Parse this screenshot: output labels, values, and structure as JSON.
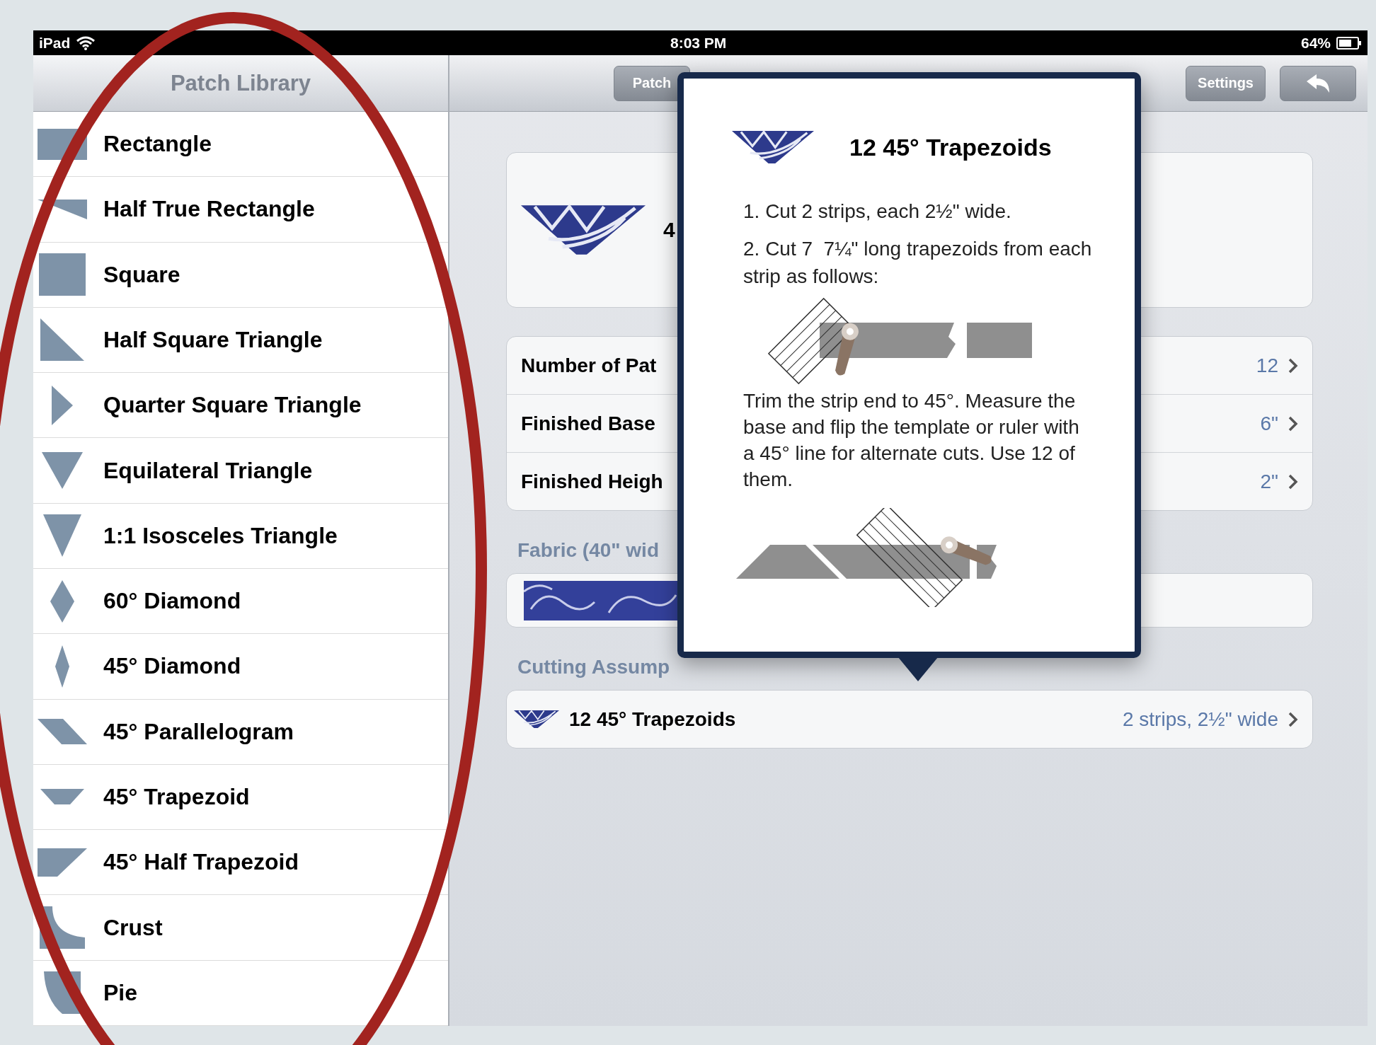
{
  "status_bar": {
    "carrier": "iPad",
    "time": "8:03 PM",
    "battery": "64%"
  },
  "sidebar": {
    "title": "Patch Library",
    "items": [
      {
        "label": "Rectangle",
        "selected": false
      },
      {
        "label": "Half True Rectangle",
        "selected": false
      },
      {
        "label": "Square",
        "selected": false
      },
      {
        "label": "Half Square Triangle",
        "selected": false
      },
      {
        "label": "Quarter Square Triangle",
        "selected": false
      },
      {
        "label": "Equilateral Triangle",
        "selected": false
      },
      {
        "label": "1:1 Isosceles Triangle",
        "selected": false
      },
      {
        "label": "60° Diamond",
        "selected": false
      },
      {
        "label": "45° Diamond",
        "selected": false
      },
      {
        "label": "45° Parallelogram",
        "selected": false
      },
      {
        "label": "45° Trapezoid",
        "selected": false
      },
      {
        "label": "45° Half Trapezoid",
        "selected": false
      },
      {
        "label": "Crust",
        "selected": false
      },
      {
        "label": "Pie",
        "selected": false
      }
    ]
  },
  "toolbar": {
    "buttons": [
      {
        "kind": "text",
        "label": "Patch"
      },
      {
        "kind": "text",
        "label": "Settings"
      },
      {
        "kind": "back"
      }
    ]
  },
  "detail": {
    "patch_title": "4",
    "rows": [
      {
        "label": "Number of Pat",
        "value": "12"
      },
      {
        "label": "Finished Base",
        "value": "6\""
      },
      {
        "label": "Finished Heigh",
        "value": "2\""
      }
    ],
    "fabric_header": "Fabric (40\" wid",
    "cutting_header": "Cutting Assump",
    "cutting_rows": [
      {
        "label": "12 45° Trapezoids",
        "value": "2 strips, 2½\" wide"
      }
    ]
  },
  "popover": {
    "title": "12 45° Trapezoids",
    "steps": [
      "1. Cut 2 strips, each 2½\" wide.",
      "2. Cut 7  7¼\" long trapezoids from each strip as follows:"
    ],
    "note": "Trim the strip end to 45°. Measure the base and flip the template or ruler with a 45° line for alternate cuts. Use 12 of them."
  }
}
